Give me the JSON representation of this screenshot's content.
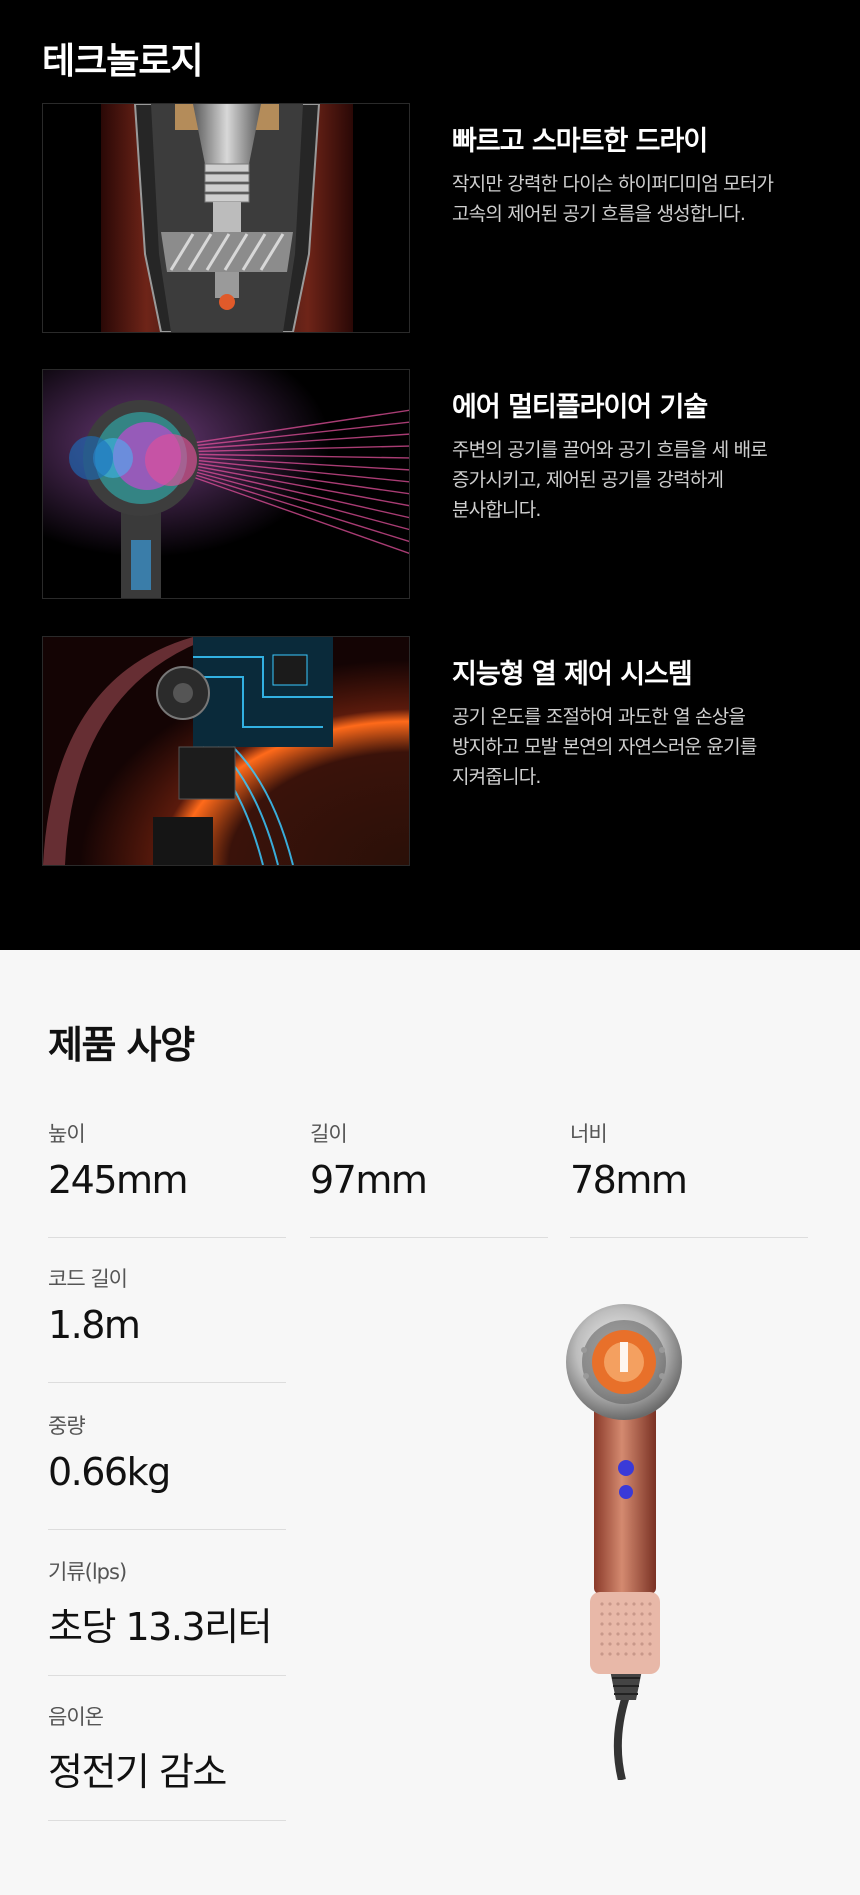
{
  "technology": {
    "title": "테크놀로지",
    "features": [
      {
        "title": "빠르고 스마트한 드라이",
        "description_lines": [
          "작지만 강력한 다이슨 하이퍼디미엄 모터가",
          "고속의 제어된 공기 흐름을 생성합니다."
        ]
      },
      {
        "title": "에어 멀티플라이어 기술",
        "description_lines": [
          "주변의 공기를 끌어와 공기 흐름을 세 배로",
          "증가시키고, 제어된 공기를 강력하게",
          "분사합니다."
        ]
      },
      {
        "title": "지능형 열 제어 시스템",
        "description_lines": [
          "공기 온도를 조절하여 과도한 열 손상을",
          "방지하고 모발 본연의 자연스러운 윤기를",
          "지켜줍니다."
        ]
      }
    ]
  },
  "specs": {
    "title": "제품 사양",
    "items": [
      {
        "label": "높이",
        "value": "245mm"
      },
      {
        "label": "길이",
        "value": "97mm"
      },
      {
        "label": "너비",
        "value": "78mm"
      },
      {
        "label": "코드 길이",
        "value": "1.8m"
      },
      {
        "label": "중량",
        "value": "0.66kg"
      },
      {
        "label": "기류(lps)",
        "value": "초당 13.3리터"
      },
      {
        "label": "음이온",
        "value": "정전기 감소"
      }
    ]
  }
}
